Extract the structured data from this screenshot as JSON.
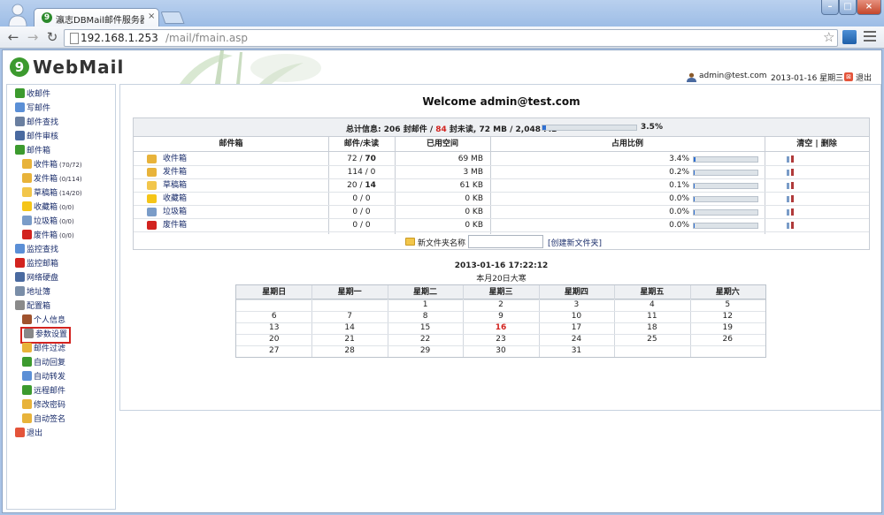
{
  "browser": {
    "tab_title": "瀛志DBMail邮件服务器 - \\",
    "tab_close": "×",
    "url_host": "192.168.1.253",
    "url_path": "/mail/fmain.asp"
  },
  "header": {
    "logo_mark": "9",
    "logo_text": "WebMail",
    "user_email": "admin@test.com",
    "date": "2013-01-16 星期三",
    "exit": "退出"
  },
  "sidebar": {
    "items": [
      {
        "label": "收邮件",
        "icon": "inbox-download-icon",
        "color": "#3c9a2e"
      },
      {
        "label": "写邮件",
        "icon": "compose-icon",
        "color": "#5b8fd6"
      },
      {
        "label": "邮件查找",
        "icon": "search-icon",
        "color": "#6a7fa0"
      },
      {
        "label": "邮件审核",
        "icon": "audit-icon",
        "color": "#4a6aa0"
      },
      {
        "label": "邮件箱",
        "icon": "mailbox-home-icon",
        "color": "#3c9a2e"
      },
      {
        "label": "收件箱",
        "count": "(70/72)",
        "icon": "inbox-icon",
        "color": "#e8b33a"
      },
      {
        "label": "发件箱",
        "count": "(0/114)",
        "icon": "outbox-icon",
        "color": "#e8b33a"
      },
      {
        "label": "草稿箱",
        "count": "(14/20)",
        "icon": "drafts-icon",
        "color": "#f2c64b"
      },
      {
        "label": "收藏箱",
        "count": "(0/0)",
        "icon": "star-icon",
        "color": "#f5c518"
      },
      {
        "label": "垃圾箱",
        "count": "(0/0)",
        "icon": "trash-icon",
        "color": "#7a9cc8"
      },
      {
        "label": "废件箱",
        "count": "(0/0)",
        "icon": "junk-icon",
        "color": "#d2231f"
      },
      {
        "label": "监控查找",
        "icon": "monitor-search-icon",
        "color": "#5b8fd6"
      },
      {
        "label": "监控邮箱",
        "icon": "monitor-mailbox-icon",
        "color": "#d2231f"
      },
      {
        "label": "网络硬盘",
        "icon": "disk-icon",
        "color": "#4a6aa0"
      },
      {
        "label": "地址簿",
        "icon": "address-book-icon",
        "color": "#7a8ea8"
      },
      {
        "label": "配置箱",
        "icon": "tools-icon",
        "color": "#8a8a8a"
      },
      {
        "label": "个人信息",
        "icon": "person-icon",
        "color": "#a0522d"
      },
      {
        "label": "参数设置",
        "icon": "gear-icon",
        "color": "#888888"
      },
      {
        "label": "邮件过滤",
        "icon": "filter-icon",
        "color": "#e8b33a"
      },
      {
        "label": "自动回复",
        "icon": "auto-reply-icon",
        "color": "#3c9a2e"
      },
      {
        "label": "自动转发",
        "icon": "auto-forward-icon",
        "color": "#5b8fd6"
      },
      {
        "label": "远程邮件",
        "icon": "remote-mail-icon",
        "color": "#3c9a2e"
      },
      {
        "label": "修改密码",
        "icon": "lock-icon",
        "color": "#e8b33a"
      },
      {
        "label": "自动签名",
        "icon": "signature-icon",
        "color": "#e8b33a"
      },
      {
        "label": "退出",
        "icon": "exit-icon",
        "color": "#e4543a"
      }
    ]
  },
  "main": {
    "welcome": "Welcome admin@test.com",
    "summary": {
      "prefix": "总计信息:",
      "total": "206",
      "total_unit": "封邮件 /",
      "unread": "84",
      "unread_unit": "封未读,",
      "storage": "72 MB / 2,048 MB",
      "percent": "3.5%",
      "fraction": 0.035
    },
    "columns": [
      "邮件箱",
      "邮件/未读",
      "已用空间",
      "占用比例",
      "清空 | 删除"
    ],
    "folders": [
      {
        "name": "收件箱",
        "total": "72",
        "unread": "70",
        "unread_bold": true,
        "used": "69 MB",
        "percent": "3.4%",
        "fraction": 0.034,
        "icon": "inbox-icon",
        "color": "#e8b33a"
      },
      {
        "name": "发件箱",
        "total": "114",
        "unread": "0",
        "unread_bold": false,
        "used": "3 MB",
        "percent": "0.2%",
        "fraction": 0.002,
        "icon": "outbox-icon",
        "color": "#e8b33a"
      },
      {
        "name": "草稿箱",
        "total": "20",
        "unread": "14",
        "unread_bold": true,
        "used": "61 KB",
        "percent": "0.1%",
        "fraction": 0.001,
        "icon": "drafts-icon",
        "color": "#f2c64b"
      },
      {
        "name": "收藏箱",
        "total": "0",
        "unread": "0",
        "unread_bold": false,
        "used": "0 KB",
        "percent": "0.0%",
        "fraction": 0.0,
        "icon": "star-icon",
        "color": "#f5c518"
      },
      {
        "name": "垃圾箱",
        "total": "0",
        "unread": "0",
        "unread_bold": false,
        "used": "0 KB",
        "percent": "0.0%",
        "fraction": 0.0,
        "icon": "trash-icon",
        "color": "#7a9cc8"
      },
      {
        "name": "废件箱",
        "total": "0",
        "unread": "0",
        "unread_bold": false,
        "used": "0 KB",
        "percent": "0.0%",
        "fraction": 0.0,
        "icon": "junk-icon",
        "color": "#d2231f"
      }
    ],
    "new_folder_label": "新文件夹名称",
    "new_folder_value": "",
    "new_folder_button": "[创建新文件夹]"
  },
  "calendar": {
    "datetime": "2013-01-16 17:22:12",
    "lunar": "本月20日大寒",
    "weekdays": [
      "星期日",
      "星期一",
      "星期二",
      "星期三",
      "星期四",
      "星期五",
      "星期六"
    ],
    "weeks": [
      [
        "",
        "",
        "1",
        "2",
        "3",
        "4",
        "5"
      ],
      [
        "6",
        "7",
        "8",
        "9",
        "10",
        "11",
        "12"
      ],
      [
        "13",
        "14",
        "15",
        "16",
        "17",
        "18",
        "19"
      ],
      [
        "20",
        "21",
        "22",
        "23",
        "24",
        "25",
        "26"
      ],
      [
        "27",
        "28",
        "29",
        "30",
        "31",
        "",
        ""
      ]
    ],
    "today": "16"
  }
}
